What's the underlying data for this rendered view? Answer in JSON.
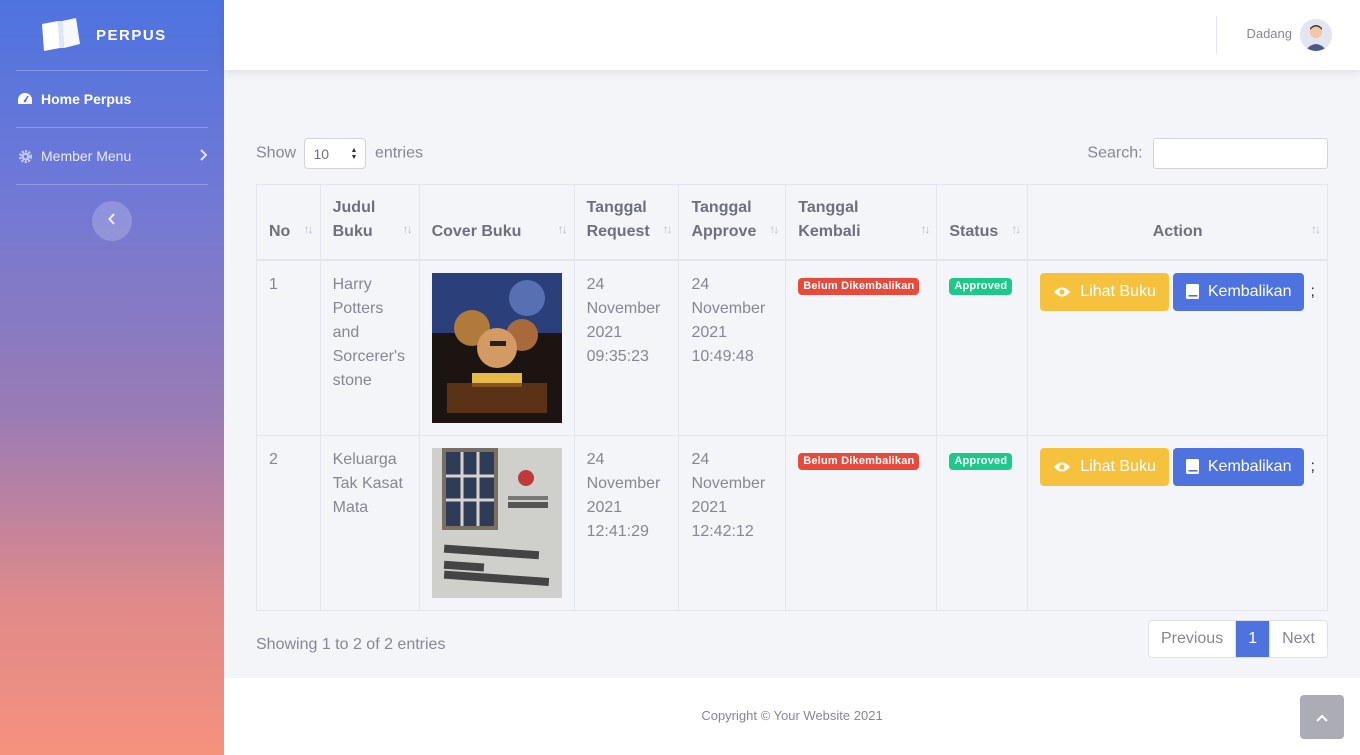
{
  "sidebar": {
    "brand": "PERPUS",
    "items": [
      {
        "label": "Home Perpus",
        "icon": "tachometer-icon"
      },
      {
        "label": "Member Menu",
        "icon": "cog-icon"
      }
    ]
  },
  "topbar": {
    "username": "Dadang"
  },
  "table_controls": {
    "show_label": "Show",
    "entries_label": "entries",
    "page_length": "10",
    "search_label": "Search:",
    "search_value": ""
  },
  "table": {
    "headers": [
      "No",
      "Judul Buku",
      "Cover Buku",
      "Tanggal Request",
      "Tanggal Approve",
      "Tanggal Kembali",
      "Status",
      "Action"
    ],
    "rows": [
      {
        "no": "1",
        "judul": "Harry Potters and Sorcerer's stone",
        "tanggal_request": "24 November 2021 09:35:23",
        "tanggal_approve": "24 November 2021 10:49:48",
        "tanggal_kembali": "Belum Dikembalikan",
        "status": "Approved"
      },
      {
        "no": "2",
        "judul": "Keluarga Tak Kasat Mata",
        "tanggal_request": "24 November 2021 12:41:29",
        "tanggal_approve": "24 November 2021 12:42:12",
        "tanggal_kembali": "Belum Dikembalikan",
        "status": "Approved"
      }
    ],
    "actions": {
      "view_label": "Lihat Buku",
      "return_label": "Kembalikan",
      "extra": ";"
    }
  },
  "pagination": {
    "info": "Showing 1 to 2 of 2 entries",
    "previous": "Previous",
    "current": "1",
    "next": "Next"
  },
  "footer": {
    "copyright": "Copyright © Your Website 2021"
  },
  "colors": {
    "primary": "#4e73df",
    "warning": "#f6c23e",
    "danger": "#e74a3b",
    "success": "#1cc88a"
  }
}
